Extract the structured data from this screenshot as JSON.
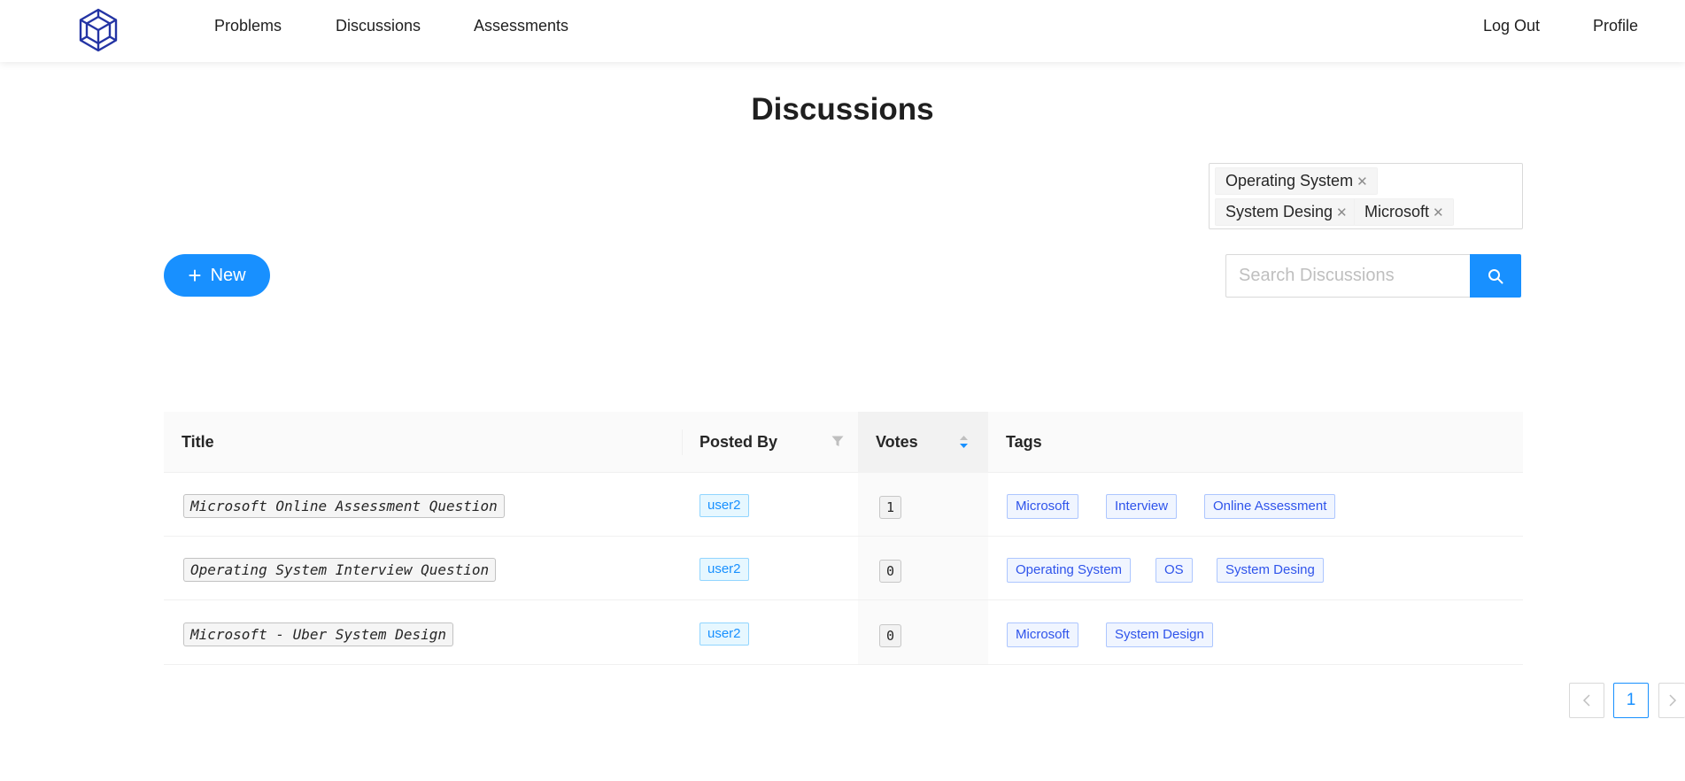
{
  "nav": {
    "logo": "logo-icon",
    "links": [
      "Problems",
      "Discussions",
      "Assessments"
    ],
    "logout": "Log Out",
    "profile": "Profile"
  },
  "page": {
    "title": "Discussions"
  },
  "filters": {
    "selected_tags": [
      "Operating System",
      "System Desing",
      "Microsoft"
    ]
  },
  "actions": {
    "new_label": "New",
    "new_icon": "plus-icon",
    "search_placeholder": "Search Discussions",
    "search_icon": "search-icon"
  },
  "table": {
    "headers": [
      "Title",
      "Posted By",
      "Votes",
      "Tags"
    ],
    "rows": [
      {
        "title": "Microsoft Online Assessment Question",
        "posted_by": "user2",
        "votes": "1",
        "tags": [
          "Microsoft",
          "Interview",
          "Online Assessment"
        ]
      },
      {
        "title": "Operating System Interview Question",
        "posted_by": "user2",
        "votes": "0",
        "tags": [
          "Operating System",
          "OS",
          "System Desing"
        ]
      },
      {
        "title": "Microsoft - Uber System Design",
        "posted_by": "user2",
        "votes": "0",
        "tags": [
          "Microsoft",
          "System Design"
        ]
      }
    ]
  },
  "pagination": {
    "current": "1"
  },
  "colors": {
    "primary": "#1890ff",
    "tag_blue": "#2f54eb",
    "logo": "#2434a4"
  }
}
